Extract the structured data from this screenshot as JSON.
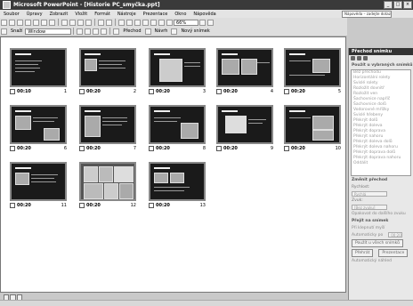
{
  "window": {
    "title": "Microsoft PowerPoint - [Historie PC_smyčka.ppt]",
    "help_box": "Nápověda – zadejte dotaz",
    "minimize": "_",
    "restore": "□",
    "close": "×"
  },
  "menu": [
    "Soubor",
    "Úpravy",
    "Zobrazit",
    "Vložit",
    "Formát",
    "Nástroje",
    "Prezentace",
    "Okno",
    "Nápověda"
  ],
  "toolbar": {
    "zoom": "66%",
    "design_label": "Snaží",
    "view_combo": "Window",
    "transition_label": "Přechod",
    "design_btn": "Návrh",
    "new_slide": "Nový snímek"
  },
  "slides": [
    {
      "num": "1",
      "time": "00:10"
    },
    {
      "num": "2",
      "time": "00:20"
    },
    {
      "num": "3",
      "time": "00:20"
    },
    {
      "num": "4",
      "time": "00:20"
    },
    {
      "num": "5",
      "time": "00:20"
    },
    {
      "num": "6",
      "time": "00:20"
    },
    {
      "num": "7",
      "time": "00:20"
    },
    {
      "num": "8",
      "time": "00:20"
    },
    {
      "num": "9",
      "time": "00:20"
    },
    {
      "num": "10",
      "time": "00:20"
    },
    {
      "num": "11",
      "time": "00:20"
    },
    {
      "num": "12",
      "time": "00:20"
    },
    {
      "num": "13",
      "time": "00:20"
    }
  ],
  "pane": {
    "title": "Přechod snímku",
    "apply_label": "Použít u vybraných snímků:",
    "transitions": [
      "Bez přechodu",
      "Horizontální rolety",
      "Svislé rolety",
      "Rozložit dovnitř",
      "Rozložit ven",
      "Šachovnice napříč",
      "Šachovnice dolů",
      "Vodorovné mřížky",
      "Svislé hřebeny",
      "Překrýt dolů",
      "Překrýt doleva",
      "Překrýt doprava",
      "Překrýt nahoru",
      "Překrýt doleva dolů",
      "Překrýt doleva nahoru",
      "Překrýt doprava dolů",
      "Překrýt doprava nahoru",
      "Oddálit"
    ],
    "modify_label": "Změnit přechod",
    "speed_label": "Rychlost:",
    "speed_value": "Rychlá",
    "sound_label": "Zvuk:",
    "sound_value": "[Bez zvuku]",
    "loop_label": "Opakovat do dalšího zvuku",
    "advance_label": "Přejít na snímek",
    "on_click": "Při klepnutí myší",
    "auto_after": "Automaticky po",
    "auto_time": "00:20",
    "apply_all": "Použít u všech snímků",
    "play": "Přehrát",
    "slideshow": "Prezentace",
    "autopreview": "Automatický náhled"
  }
}
